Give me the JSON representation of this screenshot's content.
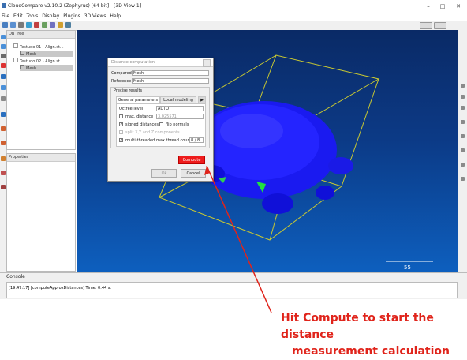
{
  "window": {
    "title": "CloudCompare v2.10.2 (Zephyrus) [64-bit] - [3D View 1]",
    "minimize": "–",
    "maximize": "□",
    "close": "✕"
  },
  "menu": [
    "File",
    "Edit",
    "Tools",
    "Display",
    "Plugins",
    "3D Views",
    "Help"
  ],
  "db_tree": {
    "title": "DB Tree",
    "items": [
      {
        "label": "Testudo 01 - Align.st..."
      },
      {
        "label": "Mesh"
      },
      {
        "label": "Testudo 02 - Align.st..."
      },
      {
        "label": "Mesh"
      }
    ]
  },
  "properties": {
    "title": "Properties"
  },
  "view": {
    "scale_label": "55"
  },
  "dialog": {
    "title": "Distance computation",
    "compared_label": "Compared",
    "compared_value": "Mesh",
    "reference_label": "Reference",
    "reference_value": "Mesh",
    "precise_results": "Precise results",
    "tabs": [
      "General parameters",
      "Local modeling"
    ],
    "tab_scroll": "▶",
    "octree_level_label": "Octree level",
    "octree_level_value": "AUTO",
    "max_distance_label": "max. distance",
    "max_distance_value": "3.025571",
    "signed_distances_label": "signed distances",
    "flip_normals_label": "flip normals",
    "split_label": "split X,Y and Z components",
    "multithreaded_label": "multi-threaded",
    "max_thread_label": "max thread count",
    "max_thread_value": "8 / 8",
    "compute_button": "Compute",
    "ok_button": "Ok",
    "cancel_button": "Cancel"
  },
  "console": {
    "title": "Console",
    "log": "[19:47:17] [computeApproxDistances] Time: 0.44 s."
  },
  "annotation": {
    "line1": "Hit Compute to start the distance",
    "line2": "measurement calculation"
  },
  "colors": {
    "accent": "#e0241b",
    "viewport_top": "#0a2a66",
    "viewport_bottom": "#0d5fbe",
    "mesh": "#1414e6",
    "bounding_box": "#c8c832"
  }
}
